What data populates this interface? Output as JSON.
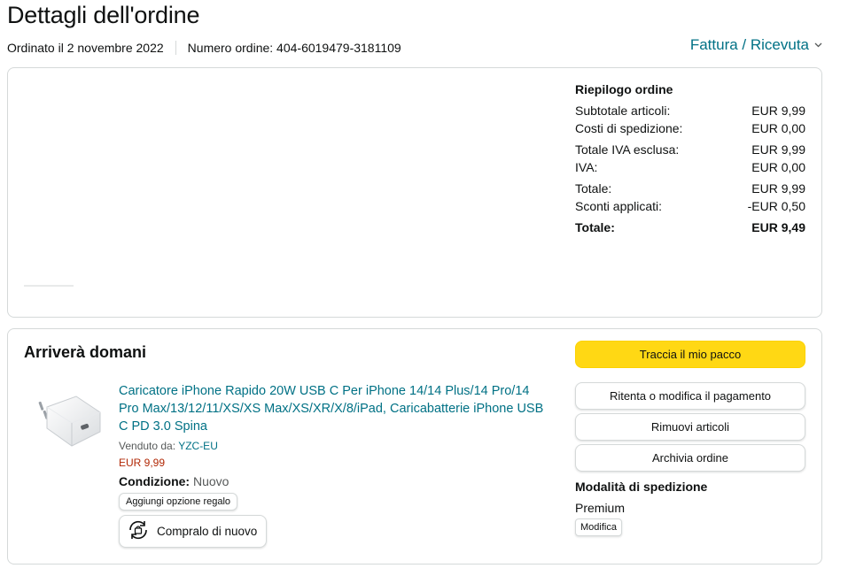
{
  "header": {
    "title": "Dettagli dell'ordine",
    "ordered_on": "Ordinato il 2 novembre 2022",
    "order_number": "Numero ordine: 404-6019479-3181109",
    "invoice_label": "Fattura / Ricevuta",
    "invoice_icon": "chevron-down-icon"
  },
  "summary": {
    "title": "Riepilogo ordine",
    "rows": [
      {
        "label": "Subtotale articoli:",
        "value": "EUR 9,99"
      },
      {
        "label": "Costi di spedizione:",
        "value": "EUR 0,00"
      },
      {
        "label": "Totale IVA esclusa:",
        "value": "EUR 9,99"
      },
      {
        "label": "IVA:",
        "value": "EUR 0,00"
      },
      {
        "label": "Totale:",
        "value": "EUR 9,99"
      },
      {
        "label": "Sconti applicati:",
        "value": "-EUR 0,50"
      },
      {
        "label": "Totale:",
        "value": "EUR 9,49"
      }
    ]
  },
  "shipment": {
    "status": "Arriverà domani",
    "product": {
      "title": "Caricatore iPhone Rapido 20W USB C Per iPhone 14/14 Plus/14 Pro/14 Pro Max/13/12/11/XS/XS Max/XS/XR/X/8/iPad, Caricabatterie iPhone USB C PD 3.0 Spina",
      "sold_by_label": "Venduto da:",
      "seller": "YZC-EU",
      "price": "EUR 9,99",
      "condition_label": "Condizione:",
      "condition_value": "Nuovo",
      "gift_label": "Aggiungi opzione regalo",
      "buy_again_label": "Compralo di nuovo",
      "buy_again_icon": "buy-again-icon"
    },
    "actions": {
      "track": "Traccia il mio pacco",
      "retry_payment": "Ritenta o modifica il pagamento",
      "remove_items": "Rimuovi articoli",
      "archive": "Archivia ordine"
    },
    "delivery": {
      "title": "Modalità di spedizione",
      "method": "Premium",
      "edit_label": "Modifica"
    }
  },
  "colors": {
    "link": "#007185",
    "price": "#b12704",
    "primary_button": "#ffd814",
    "border": "#d5d9d9"
  }
}
